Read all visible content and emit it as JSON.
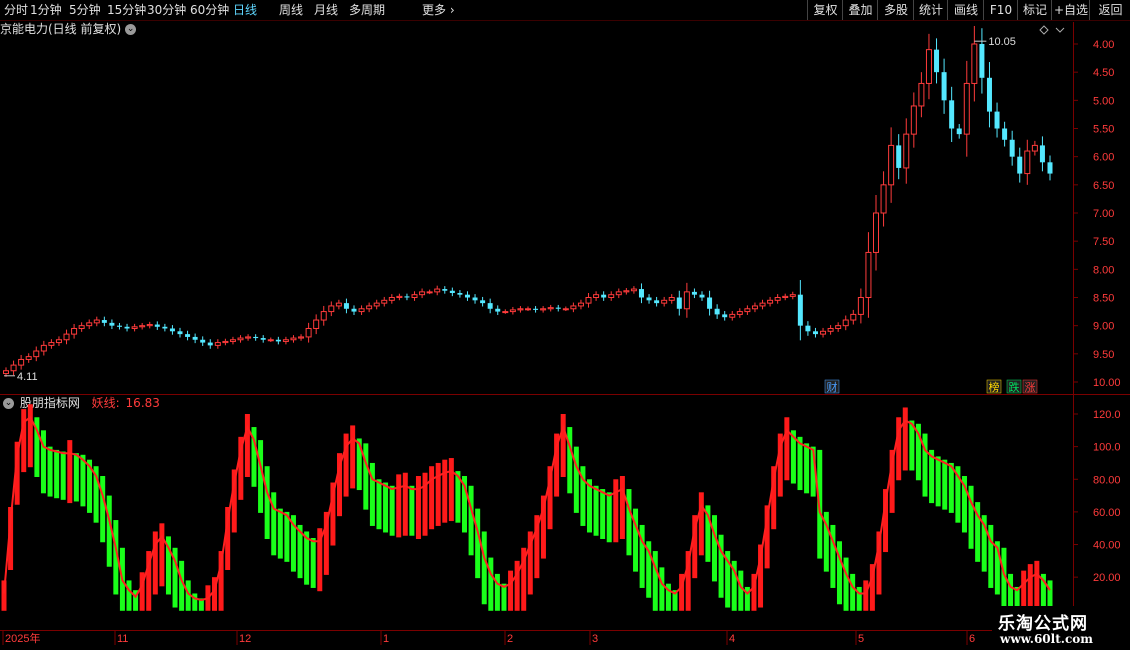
{
  "toolbar": {
    "periods": [
      "分时",
      "1分钟",
      "5分钟",
      "15分钟",
      "30分钟",
      "60分钟",
      "日线",
      "周线",
      "月线",
      "多周期"
    ],
    "active_period": "日线",
    "more_label": "更多",
    "more_icon": "chevron-right-icon",
    "buttons": [
      "复权",
      "叠加",
      "多股",
      "统计",
      "画线",
      "F10",
      "标记",
      "+自选",
      "返回"
    ]
  },
  "main_panel": {
    "title": "京能电力(日线 前复权)",
    "high_label": "10.05",
    "low_label": "4.11",
    "markers": [
      {
        "text": "财",
        "color": "#4a9eff"
      },
      {
        "text": "榜",
        "color": "#ffd700"
      },
      {
        "text": "跌",
        "color": "#00e060"
      },
      {
        "text": "涨",
        "color": "#ff3b3b"
      }
    ],
    "y_ticks": [
      "10.00",
      "9.50",
      "9.00",
      "8.50",
      "8.00",
      "7.50",
      "7.00",
      "6.50",
      "6.00",
      "5.50",
      "5.00",
      "4.50",
      "4.00"
    ]
  },
  "indicator_panel": {
    "name": "股朋指标网",
    "line_label": "妖线:",
    "line_value": "16.83",
    "y_ticks": [
      "120.0",
      "100.0",
      "80.00",
      "60.00",
      "40.00",
      "20.00"
    ]
  },
  "date_axis": [
    "2025年",
    "11",
    "12",
    "1",
    "2",
    "3",
    "4",
    "5",
    "6"
  ],
  "watermark": {
    "line1": "乐淘公式网",
    "line2": "www.60lt.com"
  },
  "colors": {
    "up": "#ff3b3b",
    "down": "#54e8ff",
    "ind_up": "#ff1a1a",
    "ind_down": "#1aff1a",
    "grid": "#7a0000"
  },
  "chart_data": [
    {
      "type": "candlestick",
      "title": "京能电力(日线 前复权)",
      "ylim": [
        3.8,
        10.5
      ],
      "y_ticks": [
        4.0,
        4.5,
        5.0,
        5.5,
        6.0,
        6.5,
        7.0,
        7.5,
        8.0,
        8.5,
        9.0,
        9.5,
        10.0
      ],
      "max_label": 10.05,
      "min_label": 4.11,
      "close": [
        4.2,
        4.3,
        4.4,
        4.45,
        4.55,
        4.65,
        4.7,
        4.75,
        4.85,
        4.95,
        5.0,
        5.05,
        5.1,
        5.05,
        5.0,
        4.98,
        4.95,
        4.98,
        5.0,
        5.02,
        4.98,
        4.95,
        4.9,
        4.85,
        4.8,
        4.75,
        4.7,
        4.65,
        4.7,
        4.72,
        4.75,
        4.78,
        4.8,
        4.78,
        4.75,
        4.75,
        4.72,
        4.75,
        4.78,
        4.8,
        4.95,
        5.1,
        5.25,
        5.35,
        5.4,
        5.3,
        5.25,
        5.3,
        5.35,
        5.4,
        5.45,
        5.5,
        5.52,
        5.5,
        5.55,
        5.6,
        5.6,
        5.65,
        5.62,
        5.58,
        5.55,
        5.5,
        5.45,
        5.4,
        5.3,
        5.25,
        5.25,
        5.28,
        5.3,
        5.3,
        5.28,
        5.3,
        5.32,
        5.3,
        5.3,
        5.35,
        5.4,
        5.5,
        5.55,
        5.5,
        5.55,
        5.6,
        5.62,
        5.65,
        5.5,
        5.45,
        5.4,
        5.45,
        5.5,
        5.3,
        5.6,
        5.55,
        5.5,
        5.3,
        5.2,
        5.15,
        5.2,
        5.25,
        5.3,
        5.35,
        5.4,
        5.45,
        5.5,
        5.52,
        5.55,
        5.0,
        4.9,
        4.85,
        4.9,
        4.95,
        5.0,
        5.1,
        5.2,
        5.5,
        6.3,
        7.0,
        7.5,
        8.2,
        7.8,
        8.4,
        8.9,
        9.3,
        9.9,
        9.5,
        9.0,
        8.5,
        8.4,
        9.3,
        10.0,
        9.4,
        8.8,
        8.5,
        8.3,
        8.0,
        7.7,
        8.1,
        8.2,
        7.9,
        7.7
      ]
    },
    {
      "type": "bar",
      "title": "股朋指标网",
      "series_label": "妖线",
      "last_value": 16.83,
      "ylim": [
        0,
        128
      ],
      "y_ticks": [
        20,
        40,
        60,
        80,
        100,
        120
      ],
      "values": [
        10,
        55,
        95,
        115,
        118,
        110,
        100,
        98,
        97,
        96,
        96,
        95,
        92,
        88,
        82,
        70,
        55,
        38,
        18,
        12,
        8,
        15,
        28,
        40,
        45,
        38,
        30,
        18,
        10,
        7,
        6,
        7,
        12,
        28,
        55,
        78,
        98,
        112,
        104,
        88,
        72,
        62,
        60,
        58,
        52,
        48,
        44,
        42,
        42,
        52,
        70,
        88,
        100,
        105,
        102,
        90,
        80,
        78,
        76,
        74,
        75,
        76,
        74,
        74,
        76,
        80,
        82,
        84,
        85,
        82,
        76,
        62,
        48,
        32,
        22,
        16,
        14,
        16,
        22,
        30,
        40,
        50,
        62,
        80,
        100,
        112,
        100,
        88,
        80,
        76,
        74,
        72,
        70,
        72,
        74,
        62,
        52,
        42,
        36,
        26,
        16,
        12,
        10,
        14,
        28,
        50,
        64,
        58,
        46,
        36,
        30,
        24,
        14,
        10,
        14,
        32,
        56,
        80,
        100,
        110,
        106,
        102,
        100,
        98,
        60,
        52,
        42,
        32,
        22,
        14,
        10,
        10,
        20,
        40,
        66,
        90,
        110,
        116,
        114,
        108,
        98,
        94,
        92,
        90,
        88,
        82,
        76,
        66,
        58,
        52,
        42,
        38,
        22,
        14,
        12,
        16,
        20,
        22,
        18,
        12
      ]
    }
  ]
}
